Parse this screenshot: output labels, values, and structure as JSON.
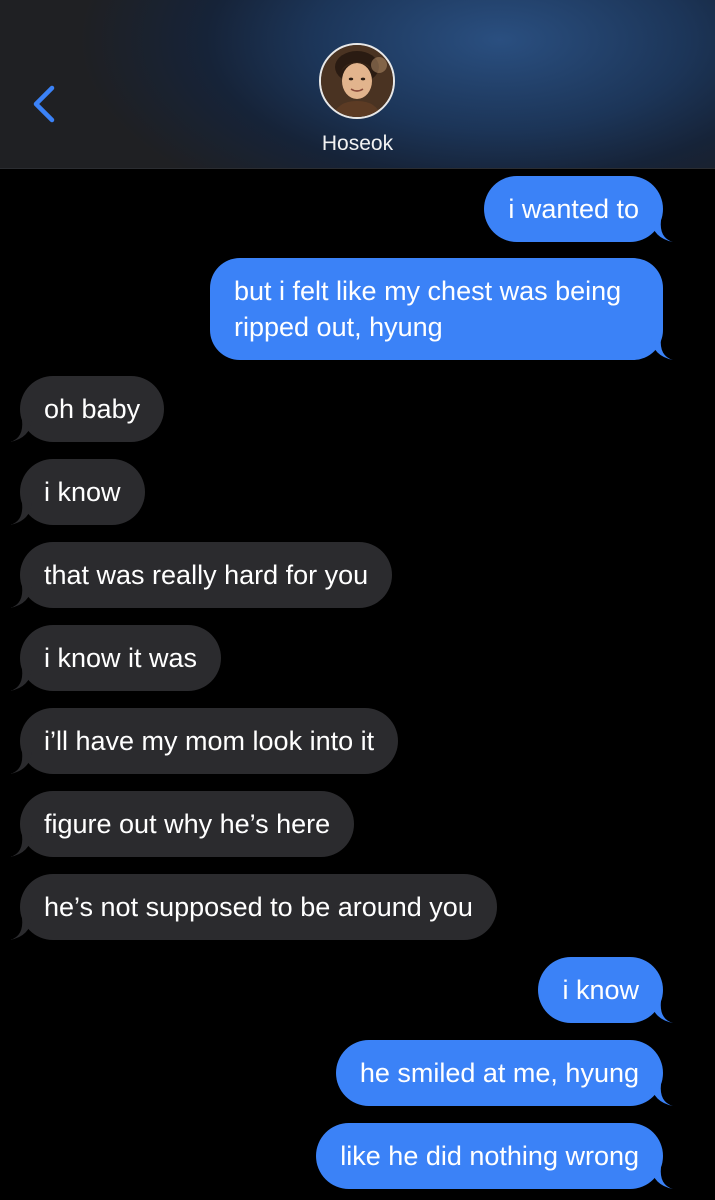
{
  "contact": {
    "name": "Hoseok"
  },
  "colors": {
    "sent": "#3b82f7",
    "received": "#2b2b2e",
    "accent": "#3b82f7"
  },
  "messages": [
    {
      "side": "sent",
      "text": "i wanted to"
    },
    {
      "side": "sent",
      "text": "but i felt like my chest was being ripped out, hyung"
    },
    {
      "side": "received",
      "text": "oh baby"
    },
    {
      "side": "received",
      "text": "i know"
    },
    {
      "side": "received",
      "text": "that was really hard for you"
    },
    {
      "side": "received",
      "text": "i know it was"
    },
    {
      "side": "received",
      "text": "i’ll have my mom look into it"
    },
    {
      "side": "received",
      "text": "figure out why he’s here"
    },
    {
      "side": "received",
      "text": "he’s not supposed to be around you"
    },
    {
      "side": "sent",
      "text": "i know"
    },
    {
      "side": "sent",
      "text": "he smiled at me, hyung"
    },
    {
      "side": "sent",
      "text": "like he did nothing wrong"
    }
  ]
}
